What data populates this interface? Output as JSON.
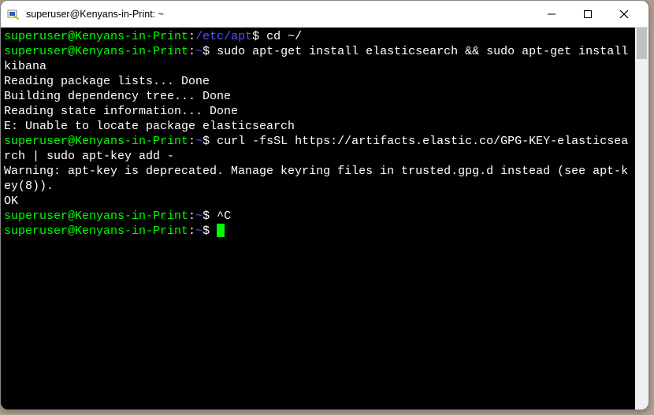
{
  "window": {
    "title": "superuser@Kenyans-in-Print: ~"
  },
  "terminal": {
    "prompt_user_host": "superuser@Kenyans-in-Print",
    "lines": {
      "l1_path": "/etc/apt",
      "l1_cmd": "cd ~/",
      "l2_path": "~",
      "l2_cmd": "sudo apt-get install elasticsearch && sudo apt-get install kibana",
      "l3": "Reading package lists... Done",
      "l4": "Building dependency tree... Done",
      "l5": "Reading state information... Done",
      "l6": "E: Unable to locate package elasticsearch",
      "l7_path": "~",
      "l7_cmd": "curl -fsSL https://artifacts.elastic.co/GPG-KEY-elasticsearch | sudo apt-key add -",
      "l8": "Warning: apt-key is deprecated. Manage keyring files in trusted.gpg.d instead (see apt-key(8)).",
      "l9": "OK",
      "l10_path": "~",
      "l10_cmd": "^C",
      "l11_path": "~",
      "dollar": "$",
      "colon": ":"
    }
  }
}
